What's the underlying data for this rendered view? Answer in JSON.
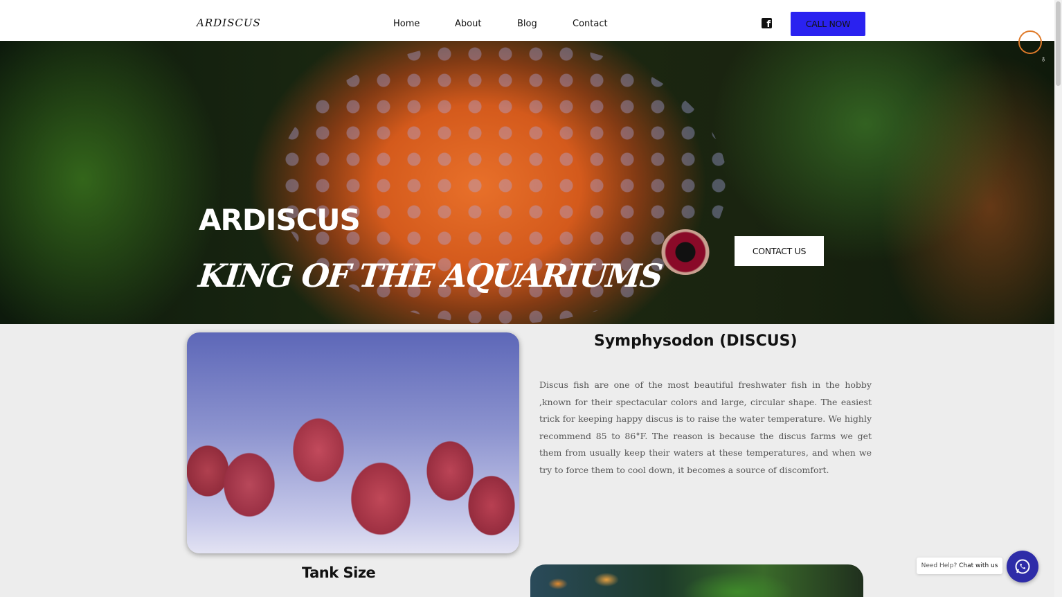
{
  "header": {
    "logo": "ARDISCUS",
    "nav": [
      {
        "label": "Home"
      },
      {
        "label": "About"
      },
      {
        "label": "Blog"
      },
      {
        "label": "Contact"
      }
    ],
    "social_icon": "facebook-icon",
    "cta_label": "CALL NOW",
    "cta_color": "#2a22f0"
  },
  "hero": {
    "title": "ARDISCUS",
    "subtitle": "KING OF THE AQUARIUMS",
    "button_label": "CONTACT US"
  },
  "content": {
    "section_title": "Symphysodon (DISCUS)",
    "body": "Discus fish are one of the most beautiful freshwater fish in the hobby ,known for their spectacular colors and large, circular shape. The easiest trick for keeping happy discus is to raise the water temperature. We highly recommend 85 to 86°F. The reason is because the discus farms we get them from usually keep their waters at these temperatures, and when we try to force them to cool down, it becomes a source of discomfort.",
    "tank_title": "Tank Size"
  },
  "chat": {
    "need_help": "Need Help?",
    "chat_with_us": "Chat with us",
    "icon": "whatsapp-icon",
    "color": "#2e2ca8"
  }
}
